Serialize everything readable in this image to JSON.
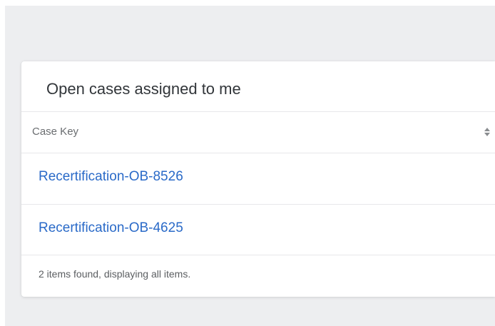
{
  "card": {
    "title": "Open cases assigned to me"
  },
  "table": {
    "column_header": "Case Key",
    "sort_icon": "sort-up-down-icon",
    "rows": [
      {
        "case_key": "Recertification-OB-8526"
      },
      {
        "case_key": "Recertification-OB-4625"
      }
    ],
    "footer": "2 items found, displaying all items."
  },
  "colors": {
    "page_background": "#edeef0",
    "card_background": "#ffffff",
    "link": "#2a6ac8",
    "title_text": "#32363a",
    "header_text": "#6a6d70",
    "divider": "#e7e8ea"
  }
}
